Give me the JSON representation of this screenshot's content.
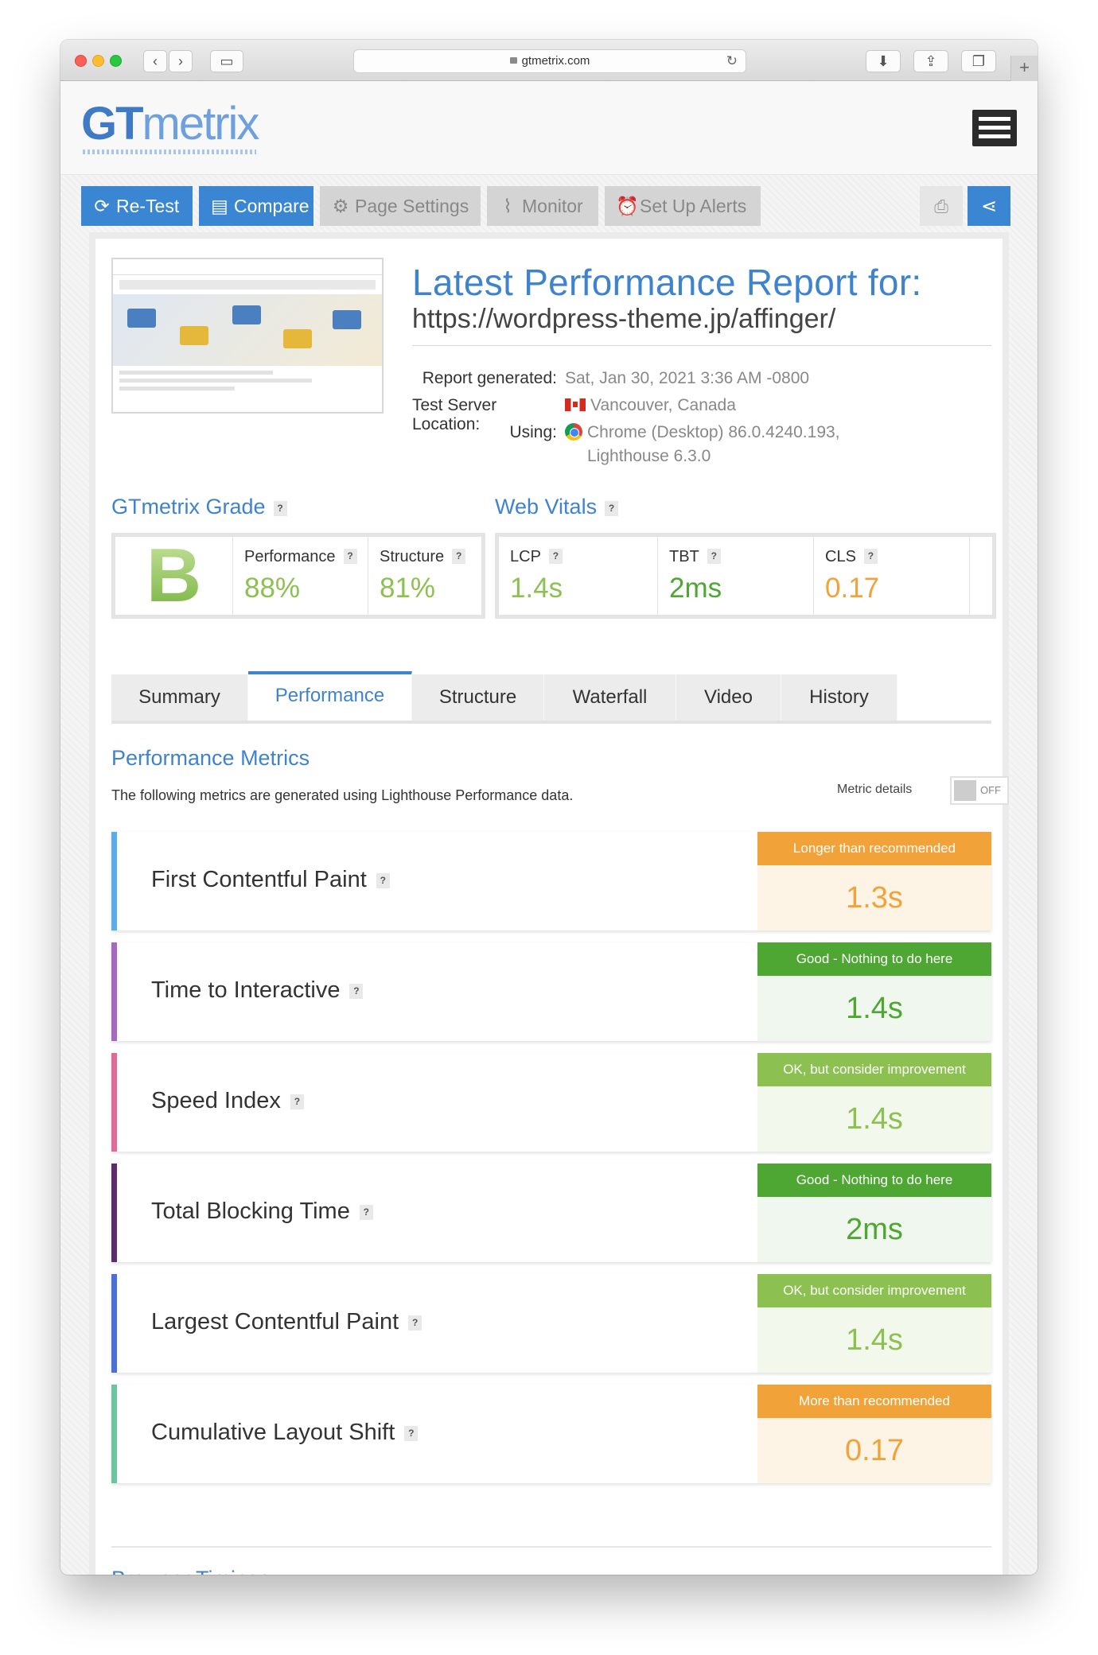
{
  "browser": {
    "address": "gtmetrix.com"
  },
  "header": {
    "logo_gt": "GT",
    "logo_metrix": "metrix"
  },
  "toolbar": {
    "retest": "Re-Test",
    "compare": "Compare",
    "page_settings": "Page Settings",
    "monitor": "Monitor",
    "alerts": "Set Up Alerts"
  },
  "report": {
    "title": "Latest Performance Report for:",
    "url": "https://wordpress-theme.jp/affinger/",
    "generated_label": "Report generated:",
    "generated_value": "Sat, Jan 30, 2021 3:36 AM -0800",
    "location_label": "Test Server Location:",
    "location_value": "Vancouver, Canada",
    "using_label": "Using:",
    "using_value_1": "Chrome (Desktop) 86.0.4240.193,",
    "using_value_2": "Lighthouse 6.3.0"
  },
  "grade": {
    "title": "GTmetrix Grade",
    "letter": "B",
    "performance_label": "Performance",
    "performance_value": "88%",
    "structure_label": "Structure",
    "structure_value": "81%"
  },
  "vitals": {
    "title": "Web Vitals",
    "lcp_label": "LCP",
    "lcp_value": "1.4s",
    "tbt_label": "TBT",
    "tbt_value": "2ms",
    "cls_label": "CLS",
    "cls_value": "0.17"
  },
  "tabs": [
    "Summary",
    "Performance",
    "Structure",
    "Waterfall",
    "Video",
    "History"
  ],
  "performance": {
    "title": "Performance Metrics",
    "description": "The following metrics are generated using Lighthouse Performance data.",
    "metric_details_label": "Metric details",
    "toggle_state": "OFF"
  },
  "metrics": [
    {
      "name": "First Contentful Paint",
      "status": "Longer than recommended",
      "value": "1.3s",
      "color": "#5aade6"
    },
    {
      "name": "Time to Interactive",
      "status": "Good - Nothing to do here",
      "value": "1.4s",
      "color": "#a569bd"
    },
    {
      "name": "Speed Index",
      "status": "OK, but consider improvement",
      "value": "1.4s",
      "color": "#e06b9a"
    },
    {
      "name": "Total Blocking Time",
      "status": "Good - Nothing to do here",
      "value": "2ms",
      "color": "#5c2d6e"
    },
    {
      "name": "Largest Contentful Paint",
      "status": "OK, but consider improvement",
      "value": "1.4s",
      "color": "#4a6fd6"
    },
    {
      "name": "Cumulative Layout Shift",
      "status": "More than recommended",
      "value": "0.17",
      "color": "#6cc5a0"
    }
  ],
  "browser_timings": {
    "title": "Browser Timings"
  },
  "colors": {
    "accent": "#3f83cc",
    "good": "#4ea733",
    "ok": "#8cc152",
    "warn": "#f1a33a"
  }
}
